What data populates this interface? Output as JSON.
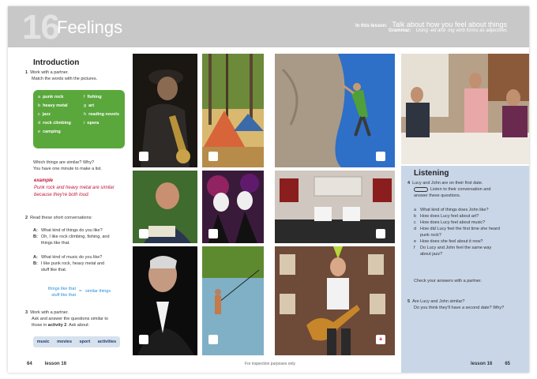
{
  "header": {
    "lesson_number": "16",
    "title": "Feelings",
    "in_this_lesson_label": "In this lesson:",
    "in_this_lesson_text": "Talk about how you feel about things",
    "grammar_label": "Grammar:",
    "grammar_text": "Using -ed and -ing verb forms as adjectives"
  },
  "intro": {
    "title": "Introduction",
    "step1_num": "1",
    "step1_line1": "Work with a partner.",
    "step1_line2": "Match the words with the pictures.",
    "words": [
      {
        "letter": "a",
        "word": "punk rock"
      },
      {
        "letter": "f",
        "word": "fishing"
      },
      {
        "letter": "b",
        "word": "heavy metal"
      },
      {
        "letter": "g",
        "word": "art"
      },
      {
        "letter": "c",
        "word": "jazz"
      },
      {
        "letter": "h",
        "word": "reading novels"
      },
      {
        "letter": "d",
        "word": "rock climbing"
      },
      {
        "letter": "i",
        "word": "opera"
      },
      {
        "letter": "e",
        "word": "camping"
      }
    ],
    "similar_q": "Which things are similar? Why?",
    "minute": "You have one minute to make a list.",
    "example_label": "example",
    "example_text": "Punk rock and heavy metal are similar because they're both loud.",
    "step2_num": "2",
    "step2_text": "Read these short conversations:",
    "conv1": [
      {
        "speaker": "A:",
        "text": "What kind of things do you like?"
      },
      {
        "speaker": "B:",
        "text": "Oh, I like rock climbing, fishing, and"
      },
      {
        "speaker": "",
        "text": "things like that."
      }
    ],
    "conv2": [
      {
        "speaker": "A:",
        "text": "What kind of music do you like?"
      },
      {
        "speaker": "B:",
        "text": "I like punk rock, heavy metal and"
      },
      {
        "speaker": "",
        "text": "stuff like that."
      }
    ],
    "blue_line1": "things like that",
    "blue_line2": "stuff like that",
    "blue_eq": "=",
    "blue_result": "similar things",
    "step3_num": "3",
    "step3_line1": "Work with a partner.",
    "step3_line2": "Ask and answer the questions similar to",
    "step3_line3_pre": "those in ",
    "step3_line3_bold": "activity 2",
    "step3_line3_post": ". Ask about:",
    "topics": [
      "music",
      "movies",
      "sport",
      "activities"
    ]
  },
  "photos": {
    "label_a": "a"
  },
  "listening": {
    "title": "Listening",
    "step4_num": "4",
    "step4_line1": "Lucy and John are on their first date.",
    "step4_line2": "Listen to their conversation and",
    "step4_line3": "answer these questions.",
    "questions": [
      {
        "letter": "a",
        "text": "What kind of things does John like?"
      },
      {
        "letter": "b",
        "text": "How does Lucy feel about art?"
      },
      {
        "letter": "c",
        "text": "How does Lucy feel about music?"
      },
      {
        "letter": "d",
        "text": "How did Lucy feel the first time she heard"
      },
      {
        "letter": "",
        "text": "punk rock?"
      },
      {
        "letter": "e",
        "text": "How does she feel about it now?"
      },
      {
        "letter": "f",
        "text": "Do Lucy and John feel the same way"
      },
      {
        "letter": "",
        "text": "about jazz?"
      }
    ],
    "check": "Check your answers with a partner.",
    "step5_num": "5",
    "step5_line1": "Are Lucy and John similar?",
    "step5_line2": "Do you think they'll have a second date? Why?"
  },
  "footer": {
    "left_page": "64",
    "left_lesson": "lesson 16",
    "center": "For inspection purposes only",
    "right_lesson": "lesson 16",
    "right_page": "65"
  }
}
